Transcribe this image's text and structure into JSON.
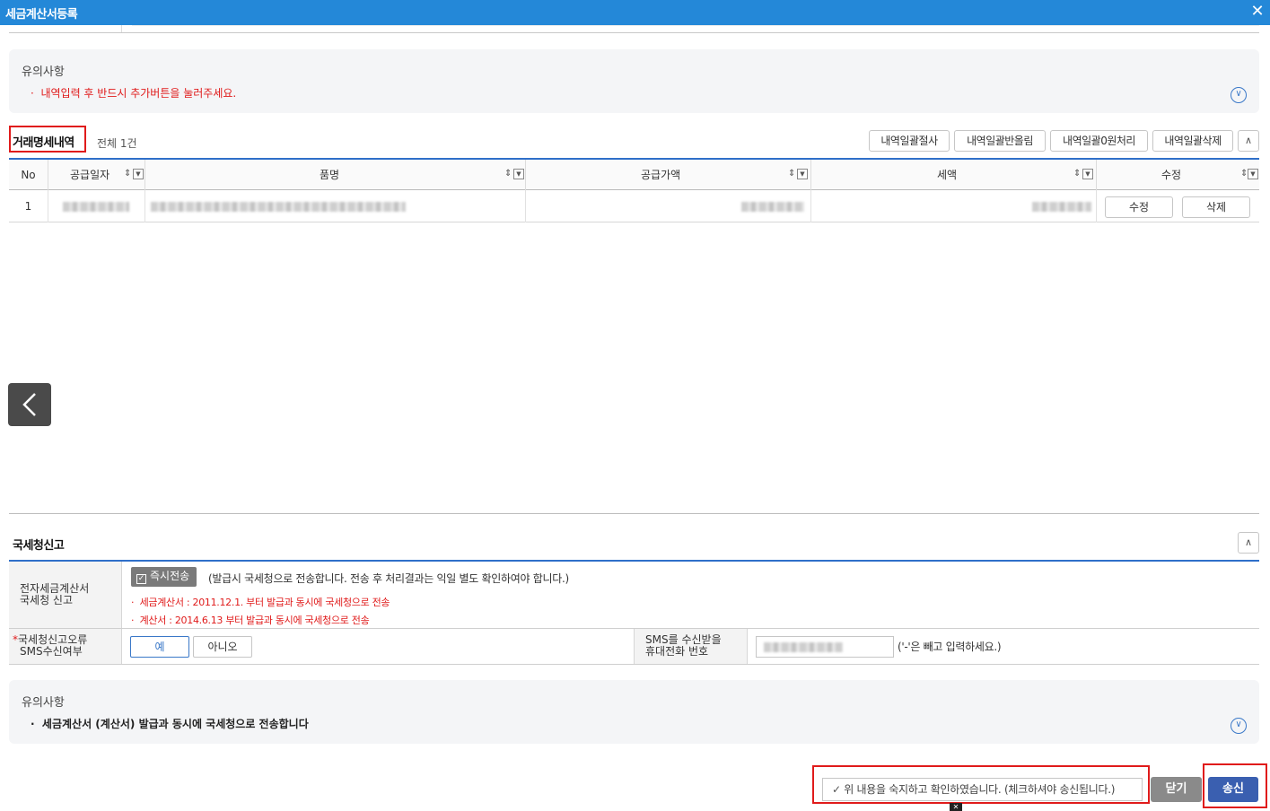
{
  "window": {
    "title": "세금계산서등록",
    "close_glyph": "✕"
  },
  "notice1": {
    "title": "유의사항",
    "items": [
      "내역입력 후 반드시 추가버튼을 눌러주세요."
    ]
  },
  "detail": {
    "title": "거래명세내역",
    "count": "전체 1건",
    "toolbar": [
      "내역일괄절사",
      "내역일괄반올림",
      "내역일괄0원처리",
      "내역일괄삭제"
    ],
    "columns": [
      "No",
      "공급일자",
      "품명",
      "공급가액",
      "세액",
      "수정"
    ],
    "rows": [
      {
        "no": "1",
        "edit": "수정",
        "delete": "삭제"
      }
    ]
  },
  "nts": {
    "title": "국세청신고",
    "row1_label": [
      "전자세금계산서",
      "국세청 신고"
    ],
    "instant_chip": "즉시전송",
    "instant_desc": "(발급시 국세청으로 전송합니다. 전송 후 처리결과는 익일 별도 확인하여야 합니다.)",
    "notes": [
      "세금계산서 : 2011.12.1. 부터 발급과 동시에 국세청으로 전송",
      "계산서 : 2014.6.13 부터 발급과 동시에 국세청으로 전송"
    ],
    "row2_required": "*",
    "row2_label": [
      "국세청신고오류",
      "SMS수신여부"
    ],
    "yes": "예",
    "no": "아니오",
    "phone_label": [
      "SMS를 수신받을",
      "휴대전화 번호"
    ],
    "phone_hint": "('-'은 빼고 입력하세요.)"
  },
  "notice2": {
    "title": "유의사항",
    "items": [
      "세금계산서 (계산서) 발급과 동시에 국세청으로 전송합니다"
    ]
  },
  "footer": {
    "confirm": "위 내용을 숙지하고 확인하였습니다. (체크하셔야 송신됩니다.)",
    "close": "닫기",
    "send": "송신"
  },
  "colors": {
    "titlebar": "#2488d8",
    "accent": "#2f6fc9",
    "highlight": "#e01b1b",
    "send": "#3a5fb0"
  },
  "icons": {
    "expand": "chevron-down-icon",
    "collapse": "chevron-up-icon",
    "prev": "chevron-left-icon"
  }
}
